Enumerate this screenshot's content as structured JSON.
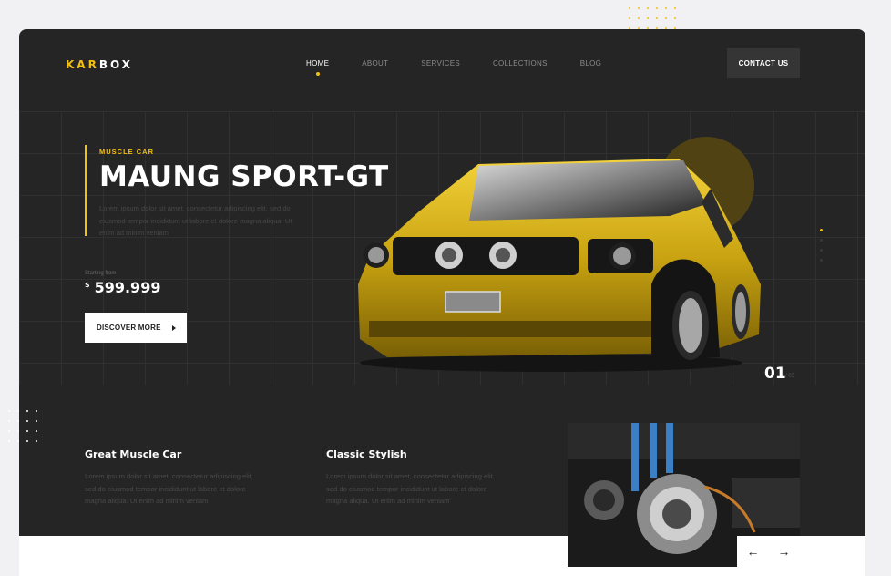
{
  "brand": {
    "logo_part1": "KAR",
    "logo_part2": "BOX",
    "accent": "#f2c013",
    "bg": "#252526"
  },
  "nav": {
    "items": [
      {
        "label": "HOME",
        "active": true
      },
      {
        "label": "ABOUT",
        "active": false
      },
      {
        "label": "SERVICES",
        "active": false
      },
      {
        "label": "COLLECTIONS",
        "active": false
      },
      {
        "label": "BLOG",
        "active": false
      }
    ],
    "contact_label": "CONTACT US"
  },
  "hero": {
    "eyebrow": "MUSCLE CAR",
    "title": "MAUNG SPORT-GT",
    "description": "Lorem ipsum dolor sit amet, consectetur adipiscing elit, sed do eiusmod tempor incididunt ut labore et dolore magna aliqua. Ut enim ad minim veniam",
    "starting_from": "Starting from",
    "currency": "$",
    "price": "599.999",
    "cta_label": "DISCOVER MORE",
    "slide_number": "01",
    "slide_total": "/ 05"
  },
  "features": [
    {
      "title": "Great Muscle Car",
      "text": "Lorem ipsum dolor sit amet, consectetur adipiscing elit, sed do eiusmod tempor incididunt ut labore et dolore magna aliqua. Ut enim ad minim veniam"
    },
    {
      "title": "Classic Stylish",
      "text": "Lorem ipsum dolor sit amet, consectetur adipiscing elit, sed do eiusmod tempor incididunt ut labore et dolore magna aliqua. Ut enim ad minim veniam"
    }
  ],
  "carousel": {
    "prev": "←",
    "next": "→"
  },
  "icons": [
    "arrow-right-icon",
    "arrow-left-icon",
    "car-image",
    "engine-image"
  ]
}
